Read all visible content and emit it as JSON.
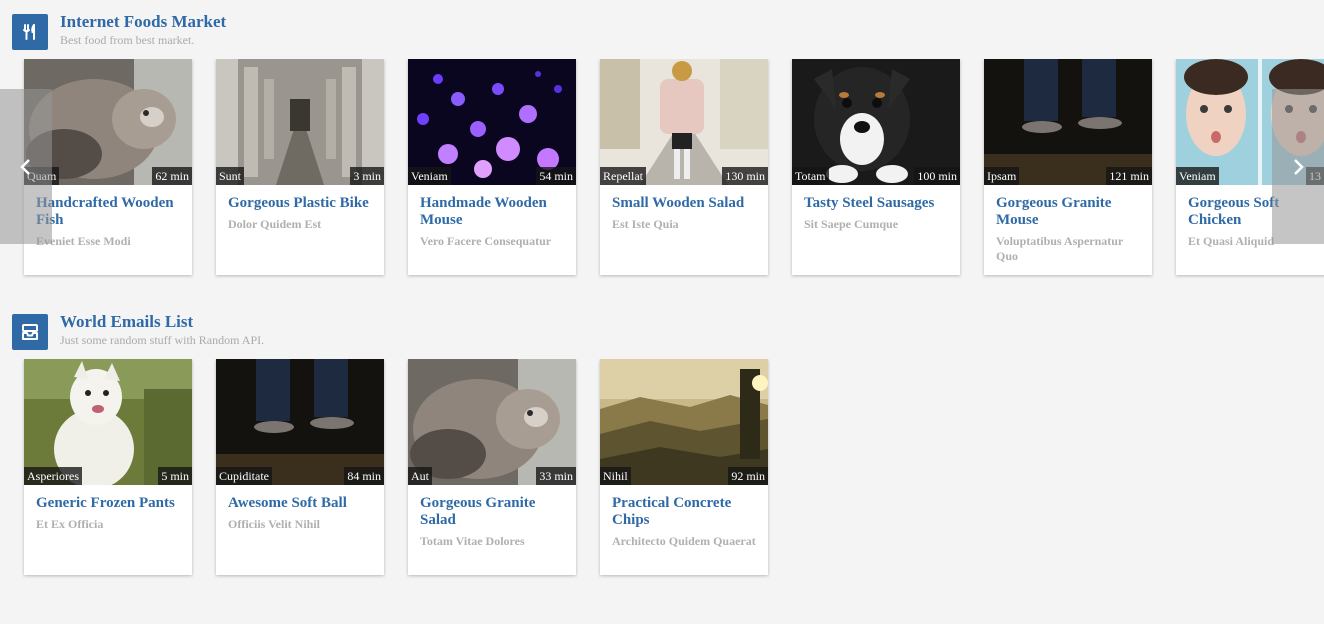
{
  "sections": [
    {
      "title": "Internet Foods Market",
      "subtitle": "Best food from best market.",
      "icon": "utensils-icon",
      "cards": [
        {
          "tag": "Quam",
          "duration": "62 min",
          "title": "Handcrafted Wooden Fish",
          "subtitle": "Eveniet Esse Modi",
          "image": "cat-photo"
        },
        {
          "tag": "Sunt",
          "duration": "3 min",
          "title": "Gorgeous Plastic Bike",
          "subtitle": "Dolor Quidem Est",
          "image": "colonnade-photo"
        },
        {
          "tag": "Veniam",
          "duration": "54 min",
          "title": "Handmade Wooden Mouse",
          "subtitle": "Vero Facere Consequatur",
          "image": "fiber-optic-photo"
        },
        {
          "tag": "Repellat",
          "duration": "130 min",
          "title": "Small Wooden Salad",
          "subtitle": "Est Iste Quia",
          "image": "woman-in-coat-photo"
        },
        {
          "tag": "Totam",
          "duration": "100 min",
          "title": "Tasty Steel Sausages",
          "subtitle": "Sit Saepe Cumque",
          "image": "puppy-photo"
        },
        {
          "tag": "Ipsam",
          "duration": "121 min",
          "title": "Gorgeous Granite Mouse",
          "subtitle": "Voluptatibus Aspernatur Quo",
          "image": "feet-photo"
        },
        {
          "tag": "Veniam",
          "duration": "13",
          "title": "Gorgeous Soft Chicken",
          "subtitle": "Et Quasi Aliquid",
          "image": "faces-photo"
        }
      ]
    },
    {
      "title": "World Emails List",
      "subtitle": "Just some random stuff with Random API.",
      "icon": "inbox-icon",
      "cards": [
        {
          "tag": "Asperiores",
          "duration": "5 min",
          "title": "Generic Frozen Pants",
          "subtitle": "Et Ex Officia",
          "image": "white-dog-photo"
        },
        {
          "tag": "Cupiditate",
          "duration": "84 min",
          "title": "Awesome Soft Ball",
          "subtitle": "Officiis Velit Nihil",
          "image": "feet-photo"
        },
        {
          "tag": "Aut",
          "duration": "33 min",
          "title": "Gorgeous Granite Salad",
          "subtitle": "Totam Vitae Dolores",
          "image": "cat-photo"
        },
        {
          "tag": "Nihil",
          "duration": "92 min",
          "title": "Practical Concrete Chips",
          "subtitle": "Architecto Quidem Quaerat",
          "image": "landscape-photo"
        }
      ]
    }
  ],
  "nav": {
    "prev_icon": "chevron-left-icon",
    "next_icon": "chevron-right-icon"
  }
}
